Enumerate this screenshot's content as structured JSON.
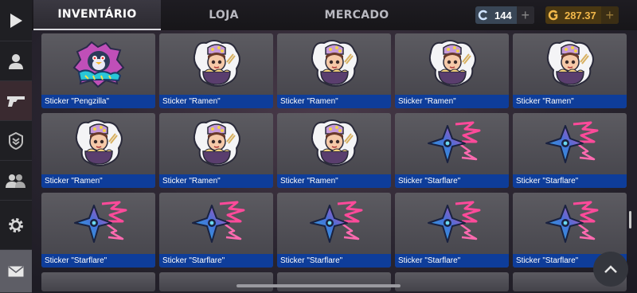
{
  "sidebar": {
    "items": [
      {
        "name": "play-icon"
      },
      {
        "name": "profile-icon"
      },
      {
        "name": "weapon-icon"
      },
      {
        "name": "rank-icon"
      },
      {
        "name": "friends-icon"
      },
      {
        "name": "gear-icon"
      },
      {
        "name": "mail-icon"
      }
    ]
  },
  "tabs": [
    {
      "label": "INVENTÁRIO",
      "active": true
    },
    {
      "label": "LOJA",
      "active": false
    },
    {
      "label": "MERCADO",
      "active": false
    }
  ],
  "currency": {
    "silver": {
      "value": "144",
      "icon": "silver-coin-icon"
    },
    "gold": {
      "value": "287.37",
      "icon": "gold-coin-icon"
    }
  },
  "inventory": {
    "items": [
      {
        "label": "Sticker \"Pengzilla\"",
        "art": "pengzilla"
      },
      {
        "label": "Sticker \"Ramen\"",
        "art": "ramen"
      },
      {
        "label": "Sticker \"Ramen\"",
        "art": "ramen"
      },
      {
        "label": "Sticker \"Ramen\"",
        "art": "ramen"
      },
      {
        "label": "Sticker \"Ramen\"",
        "art": "ramen"
      },
      {
        "label": "Sticker \"Ramen\"",
        "art": "ramen"
      },
      {
        "label": "Sticker \"Ramen\"",
        "art": "ramen"
      },
      {
        "label": "Sticker \"Ramen\"",
        "art": "ramen"
      },
      {
        "label": "Sticker \"Starflare\"",
        "art": "starflare"
      },
      {
        "label": "Sticker \"Starflare\"",
        "art": "starflare"
      },
      {
        "label": "Sticker \"Starflare\"",
        "art": "starflare"
      },
      {
        "label": "Sticker \"Starflare\"",
        "art": "starflare"
      },
      {
        "label": "Sticker \"Starflare\"",
        "art": "starflare"
      },
      {
        "label": "Sticker \"Starflare\"",
        "art": "starflare"
      },
      {
        "label": "Sticker \"Starflare\"",
        "art": "starflare"
      }
    ]
  },
  "colors": {
    "label_bg": "#0e3d9a",
    "gold": "#f2b84a"
  }
}
